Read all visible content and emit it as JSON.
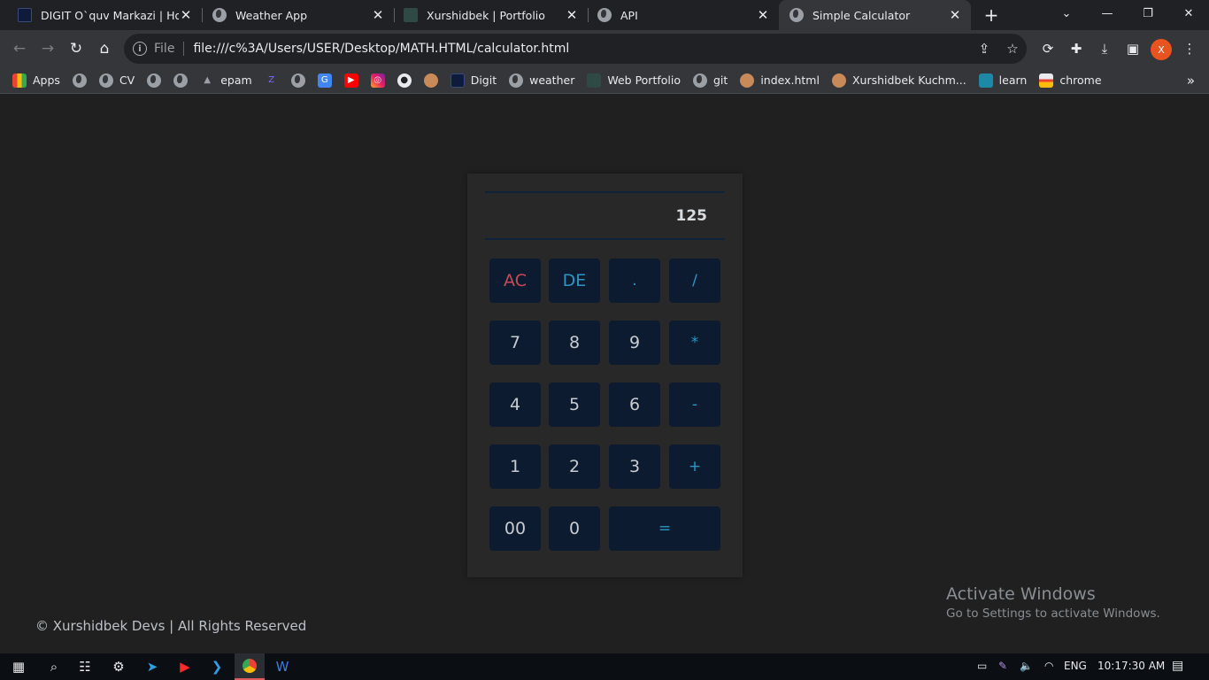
{
  "browser": {
    "tabs": [
      {
        "title": "DIGIT O`quv Markazi | Home",
        "icon": "digit-logo-icon"
      },
      {
        "title": "Weather App",
        "icon": "globe-icon"
      },
      {
        "title": "Xurshidbek | Portfolio",
        "icon": "portfolio-favicon-icon"
      },
      {
        "title": "API",
        "icon": "globe-icon"
      },
      {
        "title": "Simple Calculator",
        "icon": "globe-icon",
        "active": true
      }
    ],
    "omnibox": {
      "scheme_label": "File",
      "url": "file:///c%3A/Users/USER/Desktop/MATH.HTML/calculator.html"
    },
    "profile_initial": "X",
    "bookmarks": [
      {
        "label": "Apps",
        "icon": "apps-grid-icon"
      },
      {
        "label": "",
        "icon": "globe-icon"
      },
      {
        "label": "CV",
        "icon": "globe-icon"
      },
      {
        "label": "",
        "icon": "globe-icon"
      },
      {
        "label": "",
        "icon": "globe-icon"
      },
      {
        "label": "epam",
        "icon": "graduation-cap-icon"
      },
      {
        "label": "",
        "icon": "zone-icon"
      },
      {
        "label": "",
        "icon": "globe-icon"
      },
      {
        "label": "",
        "icon": "google-translate-icon"
      },
      {
        "label": "",
        "icon": "youtube-icon"
      },
      {
        "label": "",
        "icon": "instagram-icon"
      },
      {
        "label": "",
        "icon": "github-icon"
      },
      {
        "label": "",
        "icon": "avatar-icon"
      },
      {
        "label": "Digit",
        "icon": "digit-logo-icon"
      },
      {
        "label": "weather",
        "icon": "globe-icon"
      },
      {
        "label": "Web Portfolio",
        "icon": "portfolio-favicon-icon"
      },
      {
        "label": "git",
        "icon": "globe-icon"
      },
      {
        "label": "index.html",
        "icon": "avatar-icon"
      },
      {
        "label": "Xurshidbek Kuchm...",
        "icon": "avatar-icon"
      },
      {
        "label": "learn",
        "icon": "laptop-icon"
      },
      {
        "label": "chrome",
        "icon": "chrome-web-store-icon"
      }
    ]
  },
  "calculator": {
    "display_value": "125",
    "keys": [
      {
        "label": "AC",
        "kind": "clear"
      },
      {
        "label": "DE",
        "kind": "del"
      },
      {
        "label": ".",
        "kind": "op"
      },
      {
        "label": "/",
        "kind": "op"
      },
      {
        "label": "7",
        "kind": "num"
      },
      {
        "label": "8",
        "kind": "num"
      },
      {
        "label": "9",
        "kind": "num"
      },
      {
        "label": "*",
        "kind": "op"
      },
      {
        "label": "4",
        "kind": "num"
      },
      {
        "label": "5",
        "kind": "num"
      },
      {
        "label": "6",
        "kind": "num"
      },
      {
        "label": "-",
        "kind": "op"
      },
      {
        "label": "1",
        "kind": "num"
      },
      {
        "label": "2",
        "kind": "num"
      },
      {
        "label": "3",
        "kind": "num"
      },
      {
        "label": "+",
        "kind": "op"
      },
      {
        "label": "00",
        "kind": "num"
      },
      {
        "label": "0",
        "kind": "num"
      },
      {
        "label": "=",
        "kind": "op"
      }
    ],
    "colors": {
      "panel": "#282828",
      "key": "#0c1b30",
      "operator_text": "#2d97c3",
      "clear_text": "#c64a58"
    }
  },
  "footer": {
    "text": "© Xurshidbek Devs | All Rights Reserved"
  },
  "watermark": {
    "line1": "Activate Windows",
    "line2": "Go to Settings to activate Windows."
  },
  "taskbar": {
    "apps": [
      "start-icon",
      "search-icon",
      "task-view-icon",
      "settings-icon",
      "telegram-icon",
      "youtube-icon",
      "vscode-icon",
      "chrome-icon",
      "word-icon"
    ],
    "language": "ENG",
    "clock": "10:17:30 AM"
  }
}
